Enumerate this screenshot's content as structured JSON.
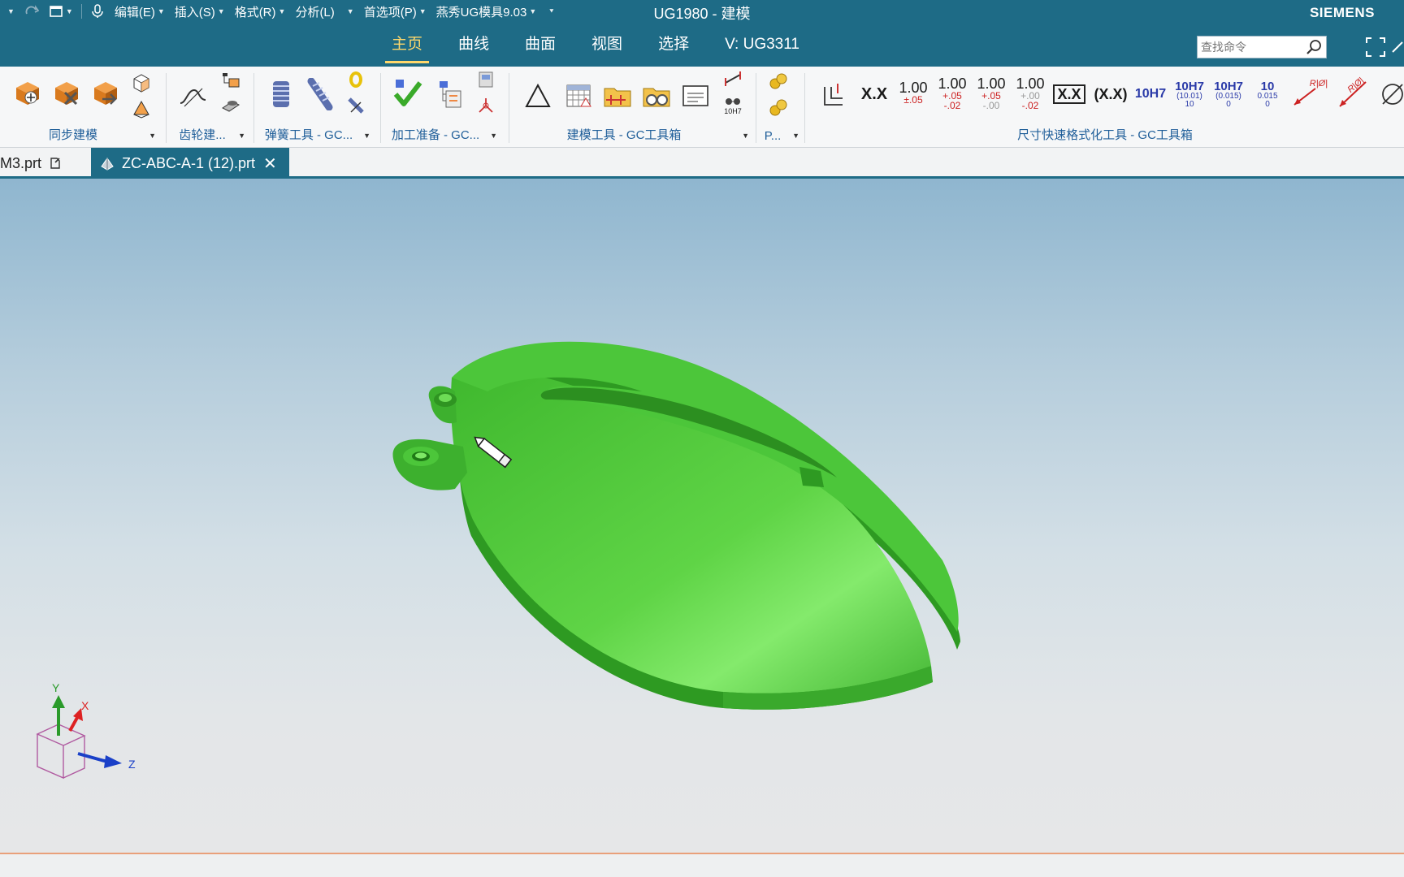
{
  "window": {
    "title": "UG1980 - 建模",
    "brand": "SIEMENS"
  },
  "quick_access": {
    "menus": [
      "编辑(E)",
      "插入(S)",
      "格式(R)",
      "分析(L)",
      "首选项(P)",
      "燕秀UG模具9.03"
    ]
  },
  "ribbon_tabs": [
    {
      "label": "主页",
      "active": true
    },
    {
      "label": "曲线",
      "active": false
    },
    {
      "label": "曲面",
      "active": false
    },
    {
      "label": "视图",
      "active": false
    },
    {
      "label": "选择",
      "active": false
    },
    {
      "label": "V:  UG3311",
      "active": false
    }
  ],
  "search": {
    "placeholder": "查找命令"
  },
  "ribbon_groups": {
    "sync_modeling": "同步建模",
    "gear": "齿轮建...",
    "spring": "弹簧工具 - GC...",
    "machining": "加工准备 - GC...",
    "modeling_tools": "建模工具 - GC工具箱",
    "p_group": "P...",
    "dim_format": "尺寸快速格式化工具 - GC工具箱"
  },
  "dim_buttons": {
    "xx": "X.X",
    "tol1_top": "1.00",
    "tol1_bot": "±.05",
    "tol2_top": "1.00",
    "tol2_mid": "+.05",
    "tol2_bot": "-.02",
    "tol3_top": "1.00",
    "tol3_mid": "+.05",
    "tol3_bot": "-.00",
    "tol4_top": "1.00",
    "tol4_mid": "+.00",
    "tol4_bot": "-.02",
    "boxed": "X.X",
    "paren": "(X.X)",
    "fit": "10H7",
    "fit2_top": "10H7",
    "fit2_mid": "(10.01)",
    "fit2_bot": "10",
    "fit3_top": "10H7",
    "fit3_mid": "(0.015)",
    "fit3_bot": "0",
    "fit4_top": "10",
    "fit4_mid": "0.015",
    "fit4_bot": "0",
    "r1": "R|Ø|",
    "r2": "R|Ø|",
    "small_10h7": "10H7"
  },
  "document_tabs": [
    {
      "label": "M3.prt",
      "active": false
    },
    {
      "label": "ZC-ABC-A-1 (12).prt",
      "active": true
    }
  ],
  "triad": {
    "x": "X",
    "y": "Y",
    "z": "Z"
  },
  "colors": {
    "chrome": "#1e6b86",
    "active_tab": "#ffd86b",
    "model_green": "#4fc43a",
    "group_label": "#1f5e99"
  }
}
